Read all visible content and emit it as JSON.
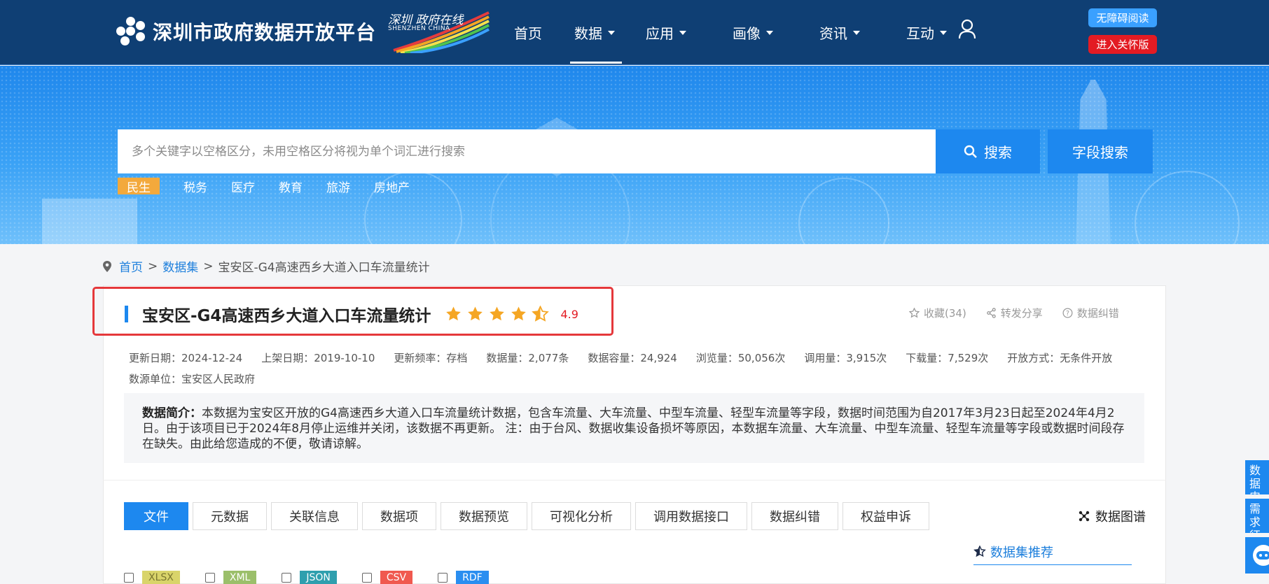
{
  "header": {
    "site_title": "深圳市政府数据开放平台",
    "sz_logo_cn": "深圳 政府在线",
    "sz_logo_en": "SHENZHEN CHINA",
    "nav": [
      {
        "label": "首页",
        "dropdown": false,
        "active": false
      },
      {
        "label": "数据",
        "dropdown": true,
        "active": true
      },
      {
        "label": "应用",
        "dropdown": true,
        "active": false
      },
      {
        "label": "画像",
        "dropdown": true,
        "active": false
      },
      {
        "label": "资讯",
        "dropdown": true,
        "active": false
      },
      {
        "label": "互动",
        "dropdown": true,
        "active": false
      }
    ],
    "a11y_label": "无障碍阅读",
    "care_label": "进入关怀版"
  },
  "search": {
    "placeholder": "多个关键字以空格区分，未用空格区分将视为单个词汇进行搜索",
    "search_label": "搜索",
    "field_search_label": "字段搜索",
    "hot_tags": [
      "民生",
      "税务",
      "医疗",
      "教育",
      "旅游",
      "房地产"
    ]
  },
  "breadcrumb": {
    "home": "首页",
    "datasets": "数据集",
    "current": "宝安区-G4高速西乡大道入口车流量统计",
    "separator": ">"
  },
  "dataset": {
    "title": "宝安区-G4高速西乡大道入口车流量统计",
    "rating_value": 4.9,
    "rating_text": "4.9",
    "stars_full": 4,
    "stars_half": 1,
    "favorite": "收藏(34)",
    "share": "转发分享",
    "error_report": "数据纠错",
    "meta": [
      "更新日期：2024-12-24",
      "上架日期：2019-10-10",
      "更新频率：存档",
      "数据量：2,077条",
      "数据容量：24,924",
      "浏览量：50,056次",
      "调用量：3,915次",
      "下载量：7,529次",
      "开放方式：无条件开放",
      "数源单位：宝安区人民政府"
    ],
    "desc_label": "数据简介：",
    "desc_text": "本数据为宝安区开放的G4高速西乡大道入口车流量统计数据，包含车流量、大车流量、中型车流量、轻型车流量等字段，数据时间范围为自2017年3月23日起至2024年4月2日。由于该项目已于2024年8月停止运维并关闭，该数据不再更新。 注：由于台风、数据收集设备损坏等原因，本数据车流量、大车流量、中型车流量、轻型车流量等字段或数据时间段存在缺失。由此给您造成的不便，敬请谅解。"
  },
  "tabs": [
    "文件",
    "元数据",
    "关联信息",
    "数据项",
    "数据预览",
    "可视化分析",
    "调用数据接口",
    "数据纠错",
    "权益申诉"
  ],
  "graph_link": "数据图谱",
  "recommend": "数据集推荐",
  "formats": [
    {
      "label": "XLSX",
      "color": "#d9d46a"
    },
    {
      "label": "XML",
      "color": "#9bbf6a"
    },
    {
      "label": "JSON",
      "color": "#2f9fae"
    },
    {
      "label": "CSV",
      "color": "#f0594f"
    },
    {
      "label": "RDF",
      "color": "#2a8ef0"
    }
  ],
  "side": {
    "apply": "数据申请",
    "demand": "需求征集"
  },
  "colors": {
    "header_bg": "#0f3f74",
    "accent": "#1d88ef",
    "star": "#f5a623",
    "rating": "#e31b23",
    "highlight_box": "#e5383b"
  }
}
